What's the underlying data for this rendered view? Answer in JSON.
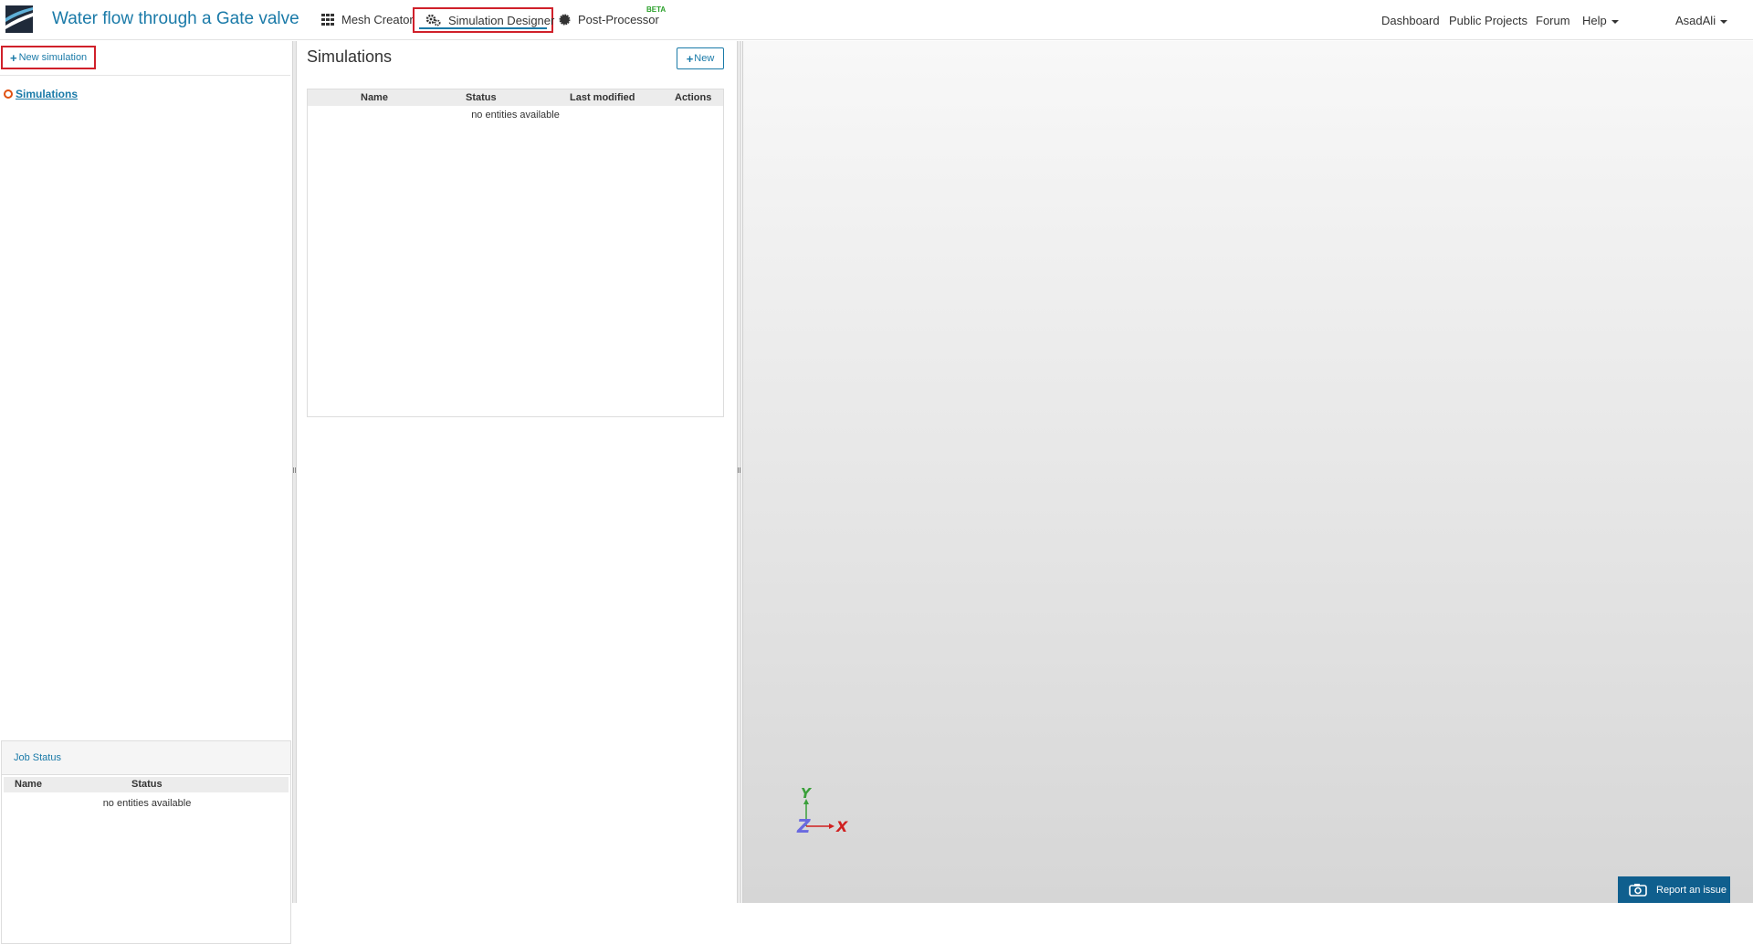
{
  "header": {
    "project_title": "Water flow through a Gate valve",
    "tabs": [
      {
        "label": "Mesh Creator",
        "icon": "grid-icon"
      },
      {
        "label": "Simulation Designer",
        "icon": "gears-icon",
        "active": true
      },
      {
        "label": "Post-Processor",
        "icon": "gear-icon",
        "badge": "BETA"
      }
    ],
    "right_nav": {
      "dashboard": "Dashboard",
      "public_projects": "Public Projects",
      "forum": "Forum",
      "help": "Help",
      "user": "AsadAli"
    }
  },
  "left_panel": {
    "new_simulation_label": "New simulation",
    "tree": [
      {
        "label": "Simulations",
        "icon": "circle-icon"
      }
    ],
    "job_status": {
      "title": "Job Status",
      "columns": [
        "Name",
        "Status"
      ],
      "empty_text": "no entities available"
    }
  },
  "simulations": {
    "title": "Simulations",
    "new_label": "New",
    "columns": [
      "Name",
      "Status",
      "Last modified",
      "Actions"
    ],
    "empty_text": "no entities available"
  },
  "viewport": {
    "axes": {
      "x": "X",
      "y": "Y",
      "z": "Z"
    },
    "report_label": "Report an issue"
  },
  "colors": {
    "accent": "#1a7aa8",
    "highlight": "#d0202a",
    "beta": "#2aa02a",
    "axis_x": "#d02020",
    "axis_y": "#3aa03a",
    "axis_z": "#6a6ae0"
  }
}
